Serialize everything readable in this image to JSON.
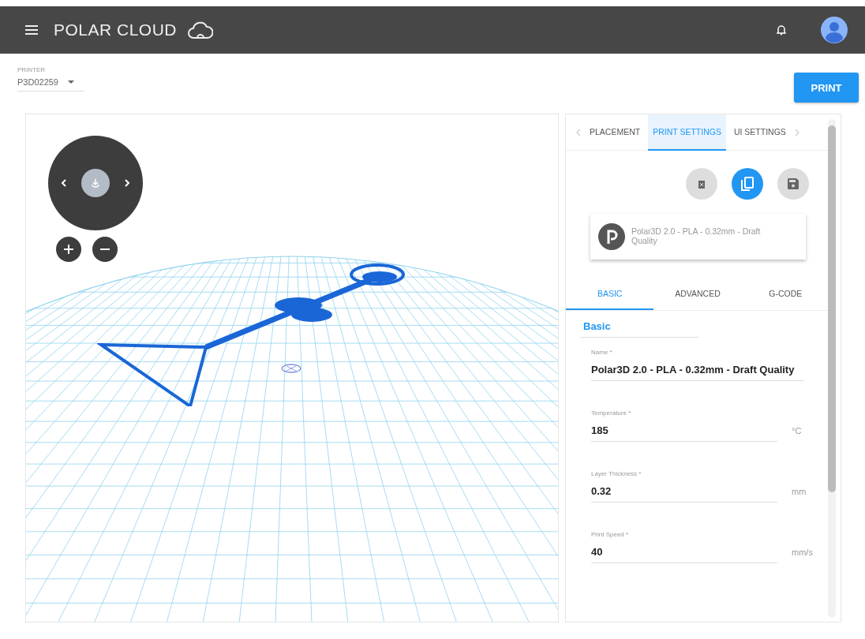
{
  "header": {
    "title": "POLAR CLOUD"
  },
  "printer": {
    "label": "PRINTER",
    "value": "P3D02259"
  },
  "print_button": "PRINT",
  "tabs": [
    {
      "label": "PLACEMENT",
      "selected": false
    },
    {
      "label": "PRINT SETTINGS",
      "selected": true
    },
    {
      "label": "UI SETTINGS",
      "selected": false
    }
  ],
  "profile": {
    "name": "Polar3D 2.0 - PLA - 0.32mm - Draft Quality"
  },
  "subtabs": [
    {
      "label": "BASIC",
      "selected": true
    },
    {
      "label": "ADVANCED",
      "selected": false
    },
    {
      "label": "G-CODE",
      "selected": false
    }
  ],
  "section": "Basic",
  "fields": [
    {
      "label": "Name *",
      "value": "Polar3D 2.0 - PLA - 0.32mm - Draft Quality"
    },
    {
      "label": "Temperature *",
      "value": "185",
      "unit": "°C"
    },
    {
      "label": "Layer Thickness *",
      "value": "0.32",
      "unit": "mm"
    },
    {
      "label": "Print Speed *",
      "value": "40",
      "unit": "mm/s"
    }
  ]
}
